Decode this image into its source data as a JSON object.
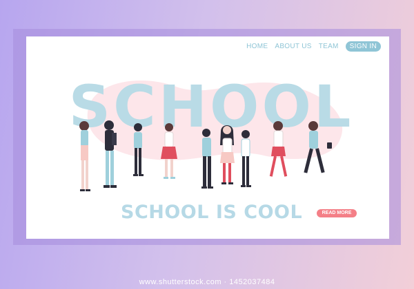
{
  "nav": {
    "links": [
      "HOME",
      "ABOUT US",
      "TEAM"
    ],
    "sign_in": "SIGN IN"
  },
  "hero": {
    "word": "SCHOOL",
    "tagline": "SCHOOL IS COOL",
    "cta": "READ MORE"
  },
  "footer": {
    "credit": "www.shutterstock.com · 1452037484"
  },
  "colors": {
    "accent": "#8fc5d6",
    "cta": "#f47f87",
    "hero_text": "#b9dbe6",
    "blob": "#fde6ea",
    "background_start": "#b7a6ef",
    "background_end": "#f2cfd8"
  }
}
